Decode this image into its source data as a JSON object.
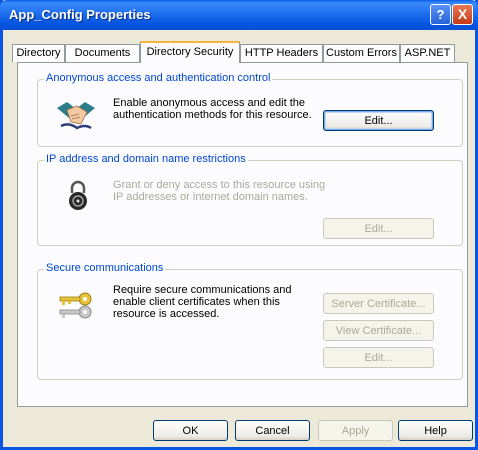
{
  "window": {
    "title": "App_Config Properties",
    "help_glyph": "?",
    "close_glyph": "X"
  },
  "tabs": [
    {
      "label": "Directory",
      "active": false
    },
    {
      "label": "Documents",
      "active": false
    },
    {
      "label": "Directory Security",
      "active": true
    },
    {
      "label": "HTTP Headers",
      "active": false
    },
    {
      "label": "Custom Errors",
      "active": false
    },
    {
      "label": "ASP.NET",
      "active": false
    }
  ],
  "groups": {
    "anonymous": {
      "title": "Anonymous access and authentication control",
      "line1": "Enable anonymous access and edit the",
      "line2": "authentication methods for this resource.",
      "edit_label": "Edit...",
      "icon": "handshake-icon"
    },
    "ip": {
      "title": "IP address and domain name restrictions",
      "line1": "Grant or deny access to this resource using",
      "line2": "IP addresses or internet domain names.",
      "edit_label": "Edit...",
      "icon": "padlock-icon"
    },
    "secure": {
      "title": "Secure communications",
      "line1": "Require secure communications and",
      "line2": "enable client certificates when this",
      "line3": "resource is accessed.",
      "server_cert_label": "Server Certificate...",
      "view_cert_label": "View Certificate...",
      "edit_label": "Edit...",
      "icon": "key-icon"
    }
  },
  "footer": {
    "ok_label": "OK",
    "cancel_label": "Cancel",
    "apply_label": "Apply",
    "help_label": "Help"
  },
  "colors": {
    "titlebar": "#0a55e3",
    "group_title": "#0046d5",
    "disabled_text": "#aca899",
    "active_tab_highlight": "#f8b43a"
  }
}
